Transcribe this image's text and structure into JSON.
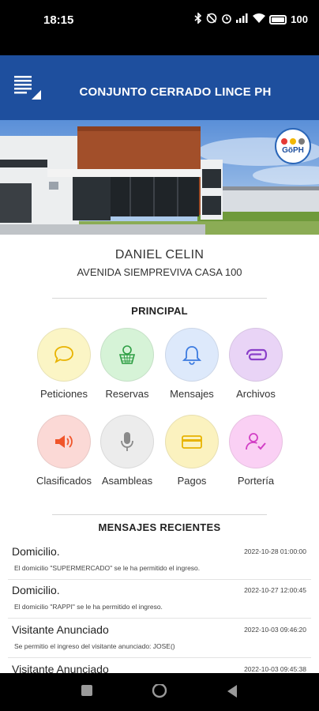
{
  "status": {
    "time": "18:15",
    "battery": "100"
  },
  "header": {
    "title": "CONJUNTO CERRADO LINCE PH"
  },
  "badge": {
    "text": "GöPH",
    "dot_colors": [
      "#e53935",
      "#f2b705",
      "#7a7a7a"
    ]
  },
  "user": {
    "name": "DANIEL CELIN",
    "address": "AVENIDA SIEMPREVIVA CASA 100"
  },
  "principal": {
    "title": "PRINCIPAL",
    "items": [
      {
        "label": "Peticiones",
        "icon": "speech-bubble-icon",
        "bg": "#fbf5c5",
        "color": "#e8b300"
      },
      {
        "label": "Reservas",
        "icon": "basketball-hoop-icon",
        "bg": "#d6f3d7",
        "color": "#2e9e44"
      },
      {
        "label": "Mensajes",
        "icon": "bell-icon",
        "bg": "#dde9fb",
        "color": "#3c7be0"
      },
      {
        "label": "Archivos",
        "icon": "paperclip-icon",
        "bg": "#e9d4f6",
        "color": "#8a3fc9"
      },
      {
        "label": "Clasificados",
        "icon": "megaphone-icon",
        "bg": "#fbd9d6",
        "color": "#f0552a"
      },
      {
        "label": "Asambleas",
        "icon": "microphone-icon",
        "bg": "#ececec",
        "color": "#8a8a8a"
      },
      {
        "label": "Pagos",
        "icon": "credit-card-icon",
        "bg": "#fbf2bf",
        "color": "#e8b300"
      },
      {
        "label": "Portería",
        "icon": "person-check-icon",
        "bg": "#fad0f4",
        "color": "#d23fc5"
      }
    ]
  },
  "recent": {
    "title": "MENSAJES RECIENTES",
    "messages": [
      {
        "title": "Domicilio.",
        "date": "2022-10-28 01:00:00",
        "body": "El domicilio \"SUPERMERCADO\" se le ha permitido el ingreso."
      },
      {
        "title": "Domicilio.",
        "date": "2022-10-27 12:00:45",
        "body": "El domicilio \"RAPPI\" se le ha permitido el ingreso."
      },
      {
        "title": "Visitante Anunciado",
        "date": "2022-10-03 09:46:20",
        "body": "Se permitio el ingreso del visitante anunciado: JOSE()"
      },
      {
        "title": "Visitante Anunciado",
        "date": "2022-10-03 09:45:38",
        "body": ""
      }
    ]
  }
}
